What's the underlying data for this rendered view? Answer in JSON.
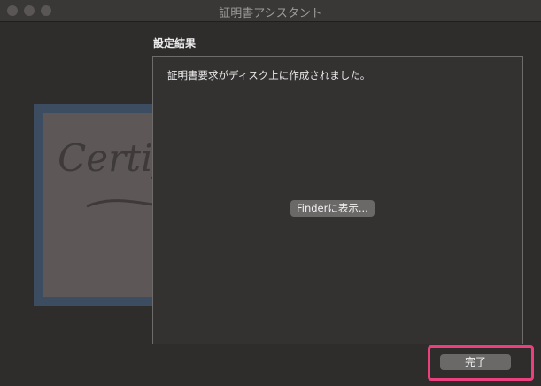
{
  "window": {
    "title": "証明書アシスタント"
  },
  "result": {
    "heading": "設定結果",
    "message": "証明書要求がディスク上に作成されました。",
    "finder_button": "Finderに表示..."
  },
  "footer": {
    "done_button": "完了"
  },
  "artwork": {
    "certificate_text": "Certificate"
  }
}
